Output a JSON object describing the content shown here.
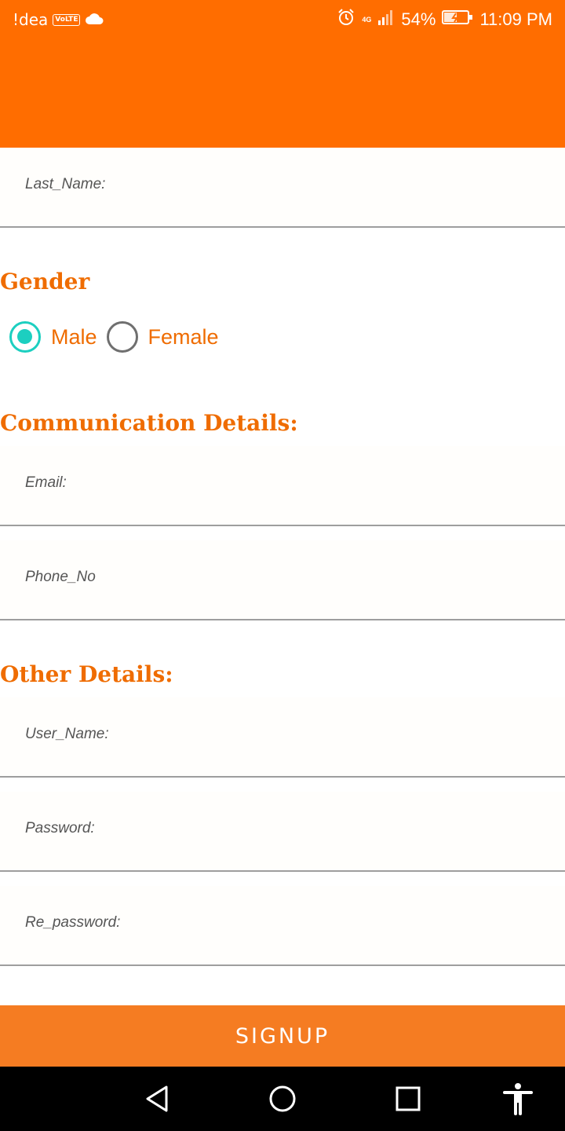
{
  "status_bar": {
    "carrier": "!dea",
    "volte_badge": "VoLTE",
    "network_type": "4G",
    "battery_percent": "54%",
    "time": "11:09 PM"
  },
  "form": {
    "last_name_hint": "Last_Name:",
    "gender": {
      "title": "Gender",
      "options": [
        {
          "label": "Male",
          "checked": true
        },
        {
          "label": "Female",
          "checked": false
        }
      ]
    },
    "communication": {
      "title": "Communication Details:",
      "email_hint": "Email:",
      "phone_hint": "Phone_No"
    },
    "other": {
      "title": "Other Details:",
      "username_hint": "User_Name:",
      "password_hint": "Password:",
      "repassword_hint": "Re_password:"
    },
    "signup_label": "SIGNUP"
  },
  "colors": {
    "header": "#ff6d00",
    "accent_text": "#ef6c00",
    "radio_checked": "#1ccfc0",
    "button": "#f57c22"
  },
  "nav_icons": [
    "back-icon",
    "home-icon",
    "recents-icon",
    "accessibility-icon"
  ]
}
